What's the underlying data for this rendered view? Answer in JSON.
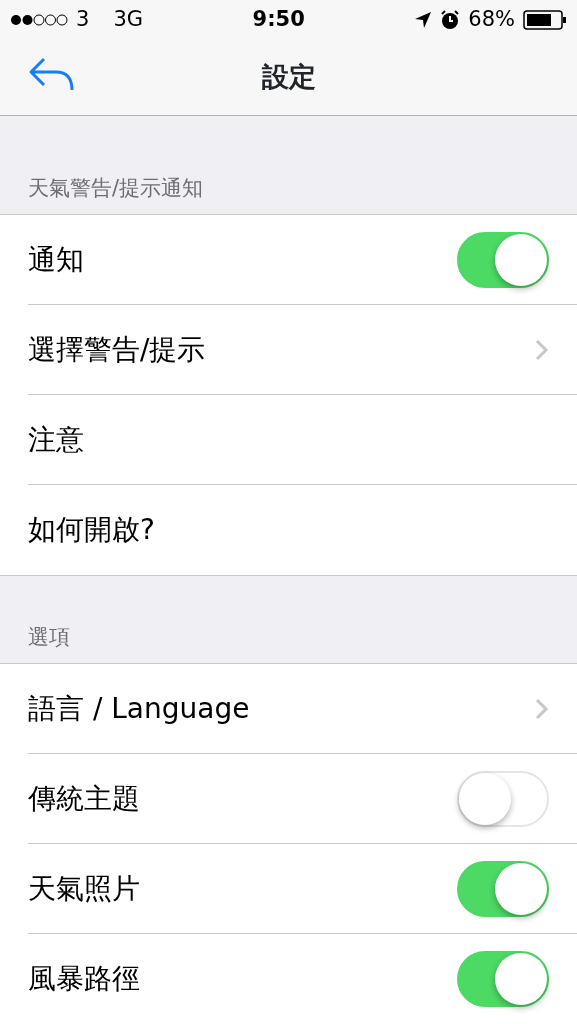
{
  "status_bar": {
    "carrier": "3",
    "network": "3G",
    "time": "9:50",
    "battery": "68%"
  },
  "nav": {
    "title": "設定"
  },
  "sections": [
    {
      "header": "天氣警告/提示通知",
      "rows": [
        {
          "label": "通知",
          "kind": "toggle",
          "on": true
        },
        {
          "label": "選擇警告/提示",
          "kind": "link"
        },
        {
          "label": "注意",
          "kind": "plain"
        },
        {
          "label": "如何開啟?",
          "kind": "plain"
        }
      ]
    },
    {
      "header": "選項",
      "rows": [
        {
          "label": "語言 / Language",
          "kind": "link"
        },
        {
          "label": "傳統主題",
          "kind": "toggle",
          "on": false
        },
        {
          "label": "天氣照片",
          "kind": "toggle",
          "on": true
        },
        {
          "label": "風暴路徑",
          "kind": "toggle",
          "on": true
        }
      ]
    }
  ]
}
